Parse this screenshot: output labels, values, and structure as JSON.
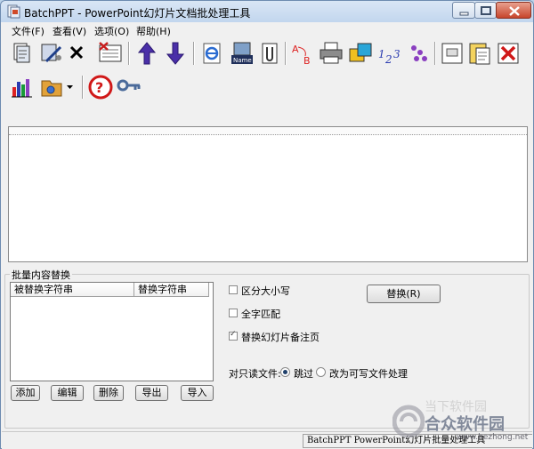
{
  "window": {
    "title": "BatchPPT - PowerPoint幻灯片文档批处理工具"
  },
  "menu": [
    "文件(F)",
    "查看(V)",
    "选项(O)",
    "帮助(H)"
  ],
  "toolbar_icons_row1": [
    "add-files-icon",
    "add-folder-icon",
    "remove-icon",
    "clear-list-icon",
    "move-up-icon",
    "move-down-icon",
    "ie-icon",
    "rename-icon",
    "attach-icon",
    "replace-text-icon",
    "print-icon",
    "convert-icon",
    "numbering-icon",
    "scatter-icon",
    "document-icon",
    "paste-notes-icon",
    "delete-icon"
  ],
  "toolbar_icons_row2": [
    "statistics-icon",
    "folder-options-icon",
    "help-icon",
    "key-icon"
  ],
  "replace_group": {
    "title": "批量内容替换",
    "table_headers": [
      "被替换字符串",
      "替换字符串"
    ],
    "buttons": {
      "add": "添加",
      "edit": "编辑",
      "delete": "删除",
      "export": "导出",
      "import": "导入"
    },
    "options": {
      "case_sensitive": {
        "label": "区分大小写",
        "checked": false
      },
      "whole_word": {
        "label": "全字匹配",
        "checked": false
      },
      "replace_notes": {
        "label": "替换幻灯片备注页",
        "checked": true
      }
    },
    "replace_button": "替换(R)",
    "readonly": {
      "label": "对只读文件:",
      "skip": "跳过",
      "convert": "改为可写文件处理",
      "selected": "skip"
    }
  },
  "status": {
    "text": "BatchPPT PowerPoint幻灯片批量处理工具"
  },
  "watermark": {
    "ghost": "当下软件园",
    "text": "合众软件园",
    "url": "www.hezhong.net"
  }
}
